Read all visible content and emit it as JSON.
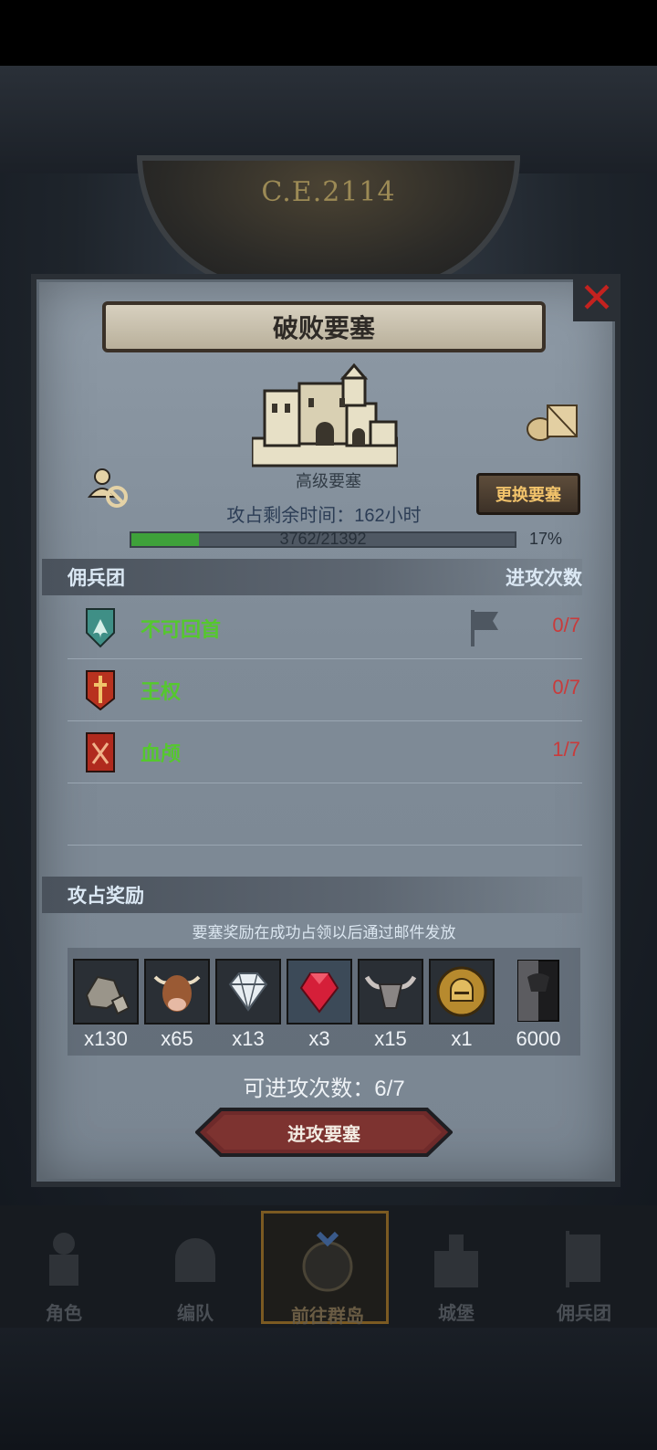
{
  "background": {
    "era_label": "C.E.2114"
  },
  "dialog": {
    "title": "破败要塞",
    "fortress_type": "高级要塞",
    "change_button": "更换要塞",
    "time_left": "攻占剩余时间：162小时",
    "progress": {
      "text": "3762/21392",
      "percent": "17%",
      "fraction": 0.176
    }
  },
  "mercenary_section": {
    "header_left": "佣兵团",
    "header_right": "进攻次数",
    "rows": [
      {
        "name": "不可回首",
        "count": "0/7",
        "emblem": "teal-leaf-shield-icon",
        "flag": true
      },
      {
        "name": "王权",
        "count": "0/7",
        "emblem": "red-sword-shield-icon",
        "flag": false
      },
      {
        "name": "血颅",
        "count": "1/7",
        "emblem": "red-axes-banner-icon",
        "flag": false
      }
    ]
  },
  "rewards_section": {
    "header": "攻占奖励",
    "note": "要塞奖励在成功占领以后通过邮件发放",
    "items": [
      {
        "icon": "stone-ore-icon",
        "qty": "x130"
      },
      {
        "icon": "bull-head-icon",
        "qty": "x65"
      },
      {
        "icon": "diamond-icon",
        "qty": "x13"
      },
      {
        "icon": "ruby-icon",
        "qty": "x3"
      },
      {
        "icon": "horned-skull-icon",
        "qty": "x15"
      },
      {
        "icon": "gold-helmet-coin-icon",
        "qty": "x1"
      },
      {
        "icon": "dark-banner-icon",
        "qty": "6000"
      }
    ]
  },
  "attacks_left": "可进攻次数：6/7",
  "attack_button": "进攻要塞",
  "nav": [
    {
      "label": "角色",
      "icon": "knight-icon",
      "active": false
    },
    {
      "label": "编队",
      "icon": "helmet-icon",
      "active": false
    },
    {
      "label": "前往群岛",
      "icon": "globe-icon",
      "active": true
    },
    {
      "label": "城堡",
      "icon": "castle-icon",
      "active": false
    },
    {
      "label": "佣兵团",
      "icon": "banner-icon",
      "active": false
    }
  ],
  "colors": {
    "panel": "#87939f",
    "merc_name": "#55c82e",
    "merc_count": "#c93b3b",
    "close": "#c3221f",
    "progress_fill": "#3ea13a",
    "change_button_text": "#f2c36b"
  }
}
